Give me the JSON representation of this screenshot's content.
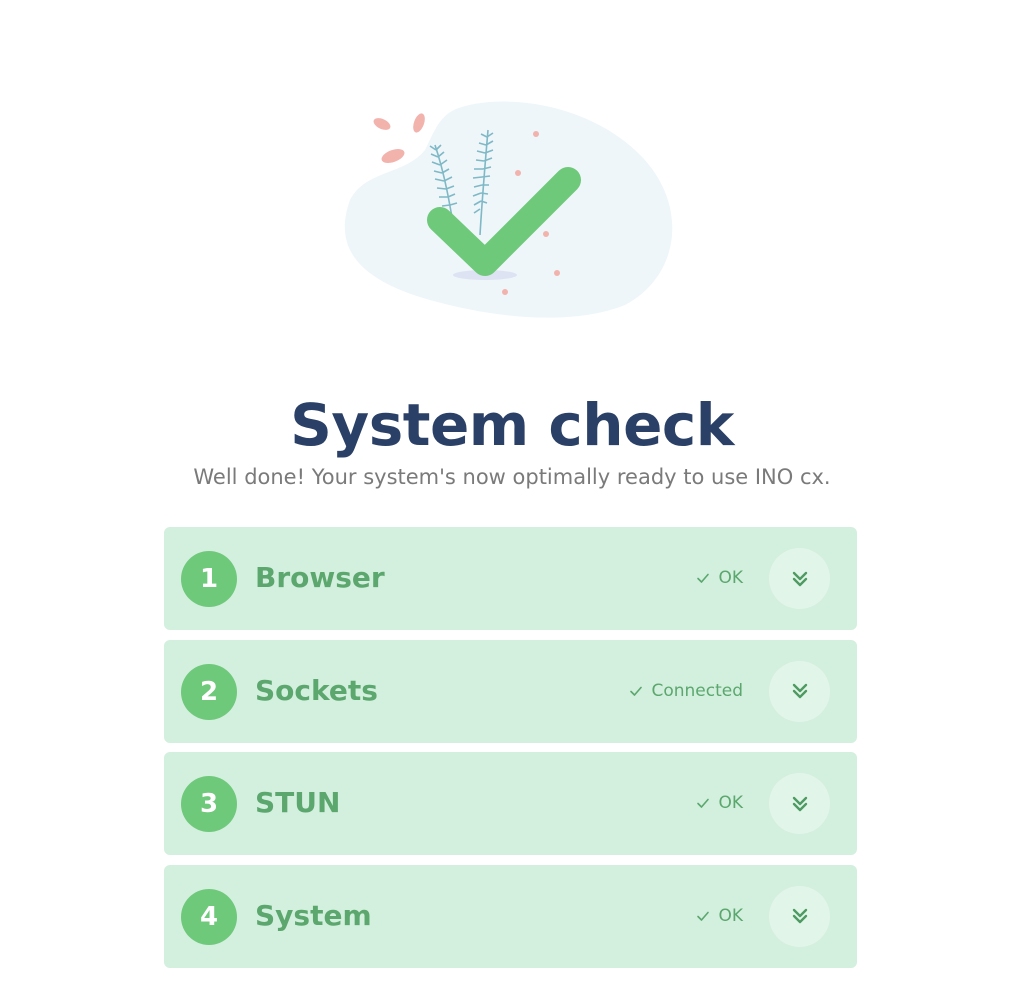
{
  "header": {
    "title": "System check",
    "subtitle": "Well done! Your system's now optimally ready to use INO cx."
  },
  "checks": [
    {
      "number": "1",
      "label": "Browser",
      "status": "OK"
    },
    {
      "number": "2",
      "label": "Sockets",
      "status": "Connected"
    },
    {
      "number": "3",
      "label": "STUN",
      "status": "OK"
    },
    {
      "number": "4",
      "label": "System",
      "status": "OK"
    }
  ],
  "icons": {
    "illustration": "success-checkmark-illustration-icon",
    "status": "check-icon",
    "expand": "chevron-double-down-icon"
  },
  "colors": {
    "title": "#2a4066",
    "subtitle": "#7a7a7a",
    "row_background": "#d3efde",
    "accent_green": "#6ec97a",
    "label_green": "#5ba76e",
    "blob": "#eef6f9",
    "leaf_pink": "#f2b3ad"
  }
}
